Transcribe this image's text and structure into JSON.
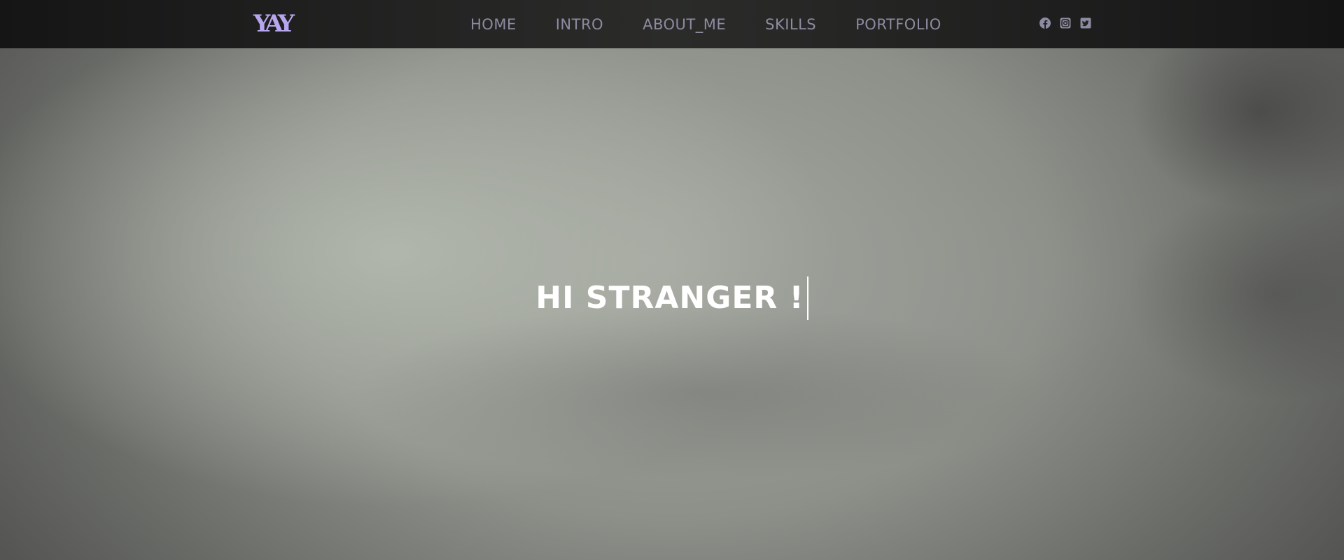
{
  "brand": {
    "logo_text": "YAY",
    "logo_color": "#b7a6ee"
  },
  "nav": {
    "items": [
      {
        "label": "HOME"
      },
      {
        "label": "INTRO"
      },
      {
        "label": "ABOUT_ME"
      },
      {
        "label": "SKILLS"
      },
      {
        "label": "PORTFOLIO"
      }
    ]
  },
  "social": {
    "icons": [
      "facebook-icon",
      "instagram-icon",
      "twitter-icon"
    ]
  },
  "hero": {
    "headline": "HI STRANGER !"
  }
}
